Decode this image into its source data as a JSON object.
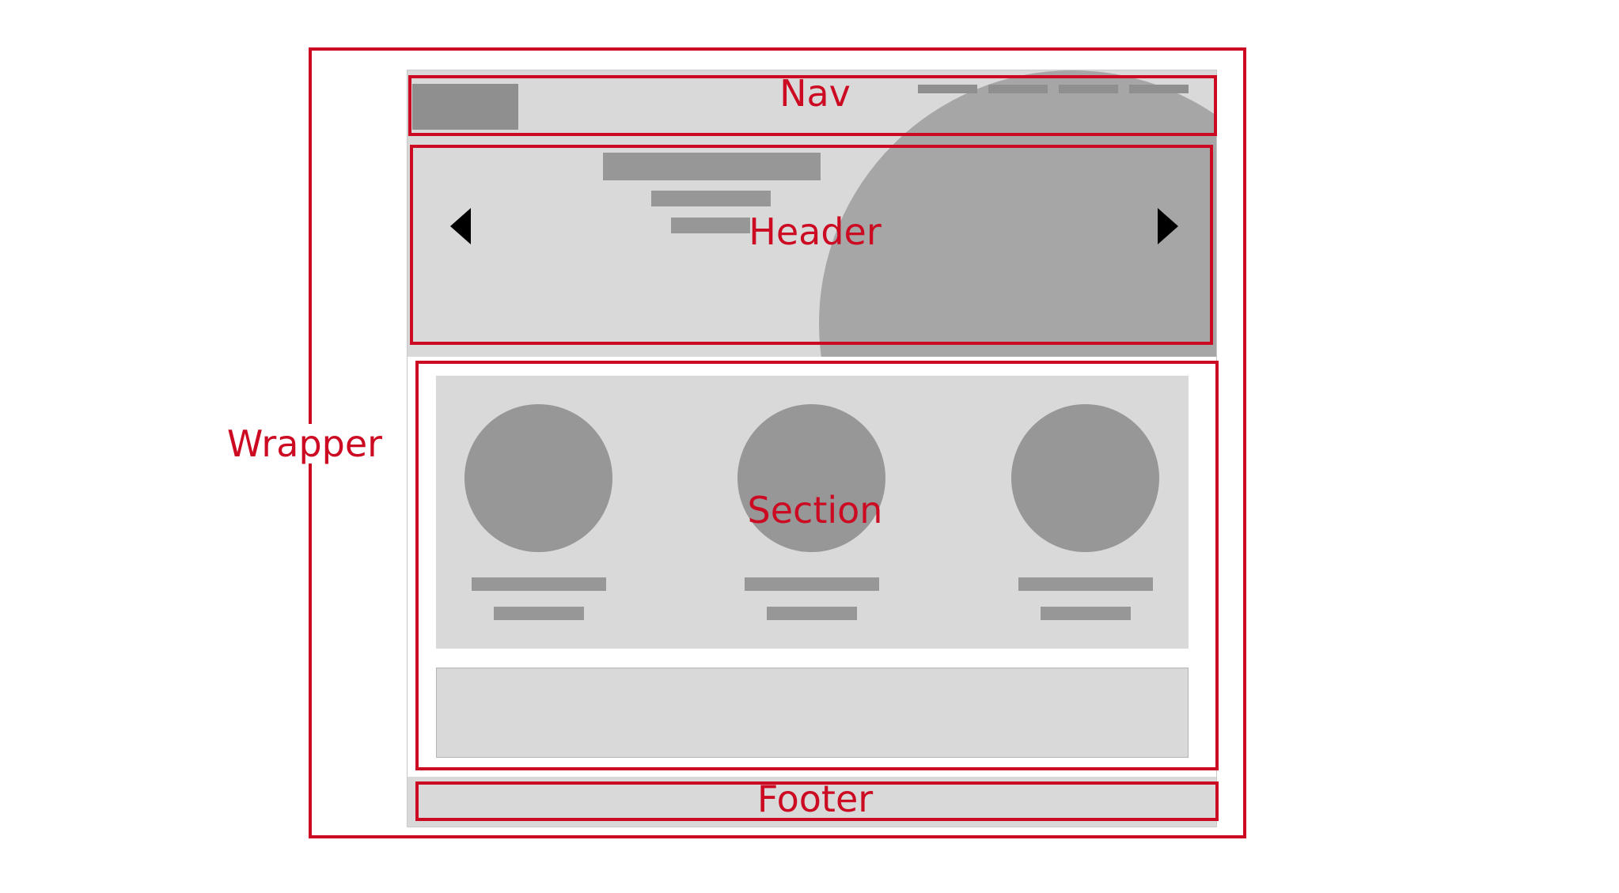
{
  "labels": {
    "wrapper": "Wrapper",
    "nav": "Nav",
    "header": "Header",
    "section": "Section",
    "footer": "Footer"
  },
  "colors": {
    "annotation": "#cc0a22",
    "placeholder_fill": "#d9d9d9",
    "placeholder_block": "#979797",
    "hero_circle": "#a6a6a6",
    "arrow": "#000000"
  },
  "icons": {
    "prev": "triangle-left",
    "next": "triangle-right"
  }
}
